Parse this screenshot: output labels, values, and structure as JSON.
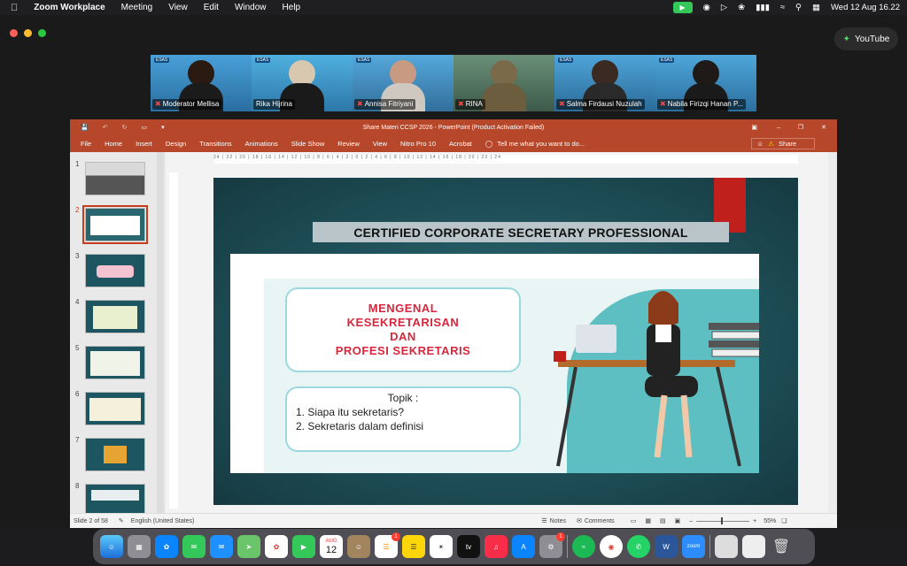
{
  "menubar": {
    "app": "Zoom Workplace",
    "items": [
      "Meeting",
      "View",
      "Edit",
      "Window",
      "Help"
    ],
    "datetime": "Wed 12 Aug  16.22"
  },
  "youtube": {
    "label": "YouTube"
  },
  "participants": [
    {
      "name": "Moderator Mellisa",
      "active": false
    },
    {
      "name": "Rika Hijrina",
      "active": true
    },
    {
      "name": "Annisa Fitriyani",
      "active": false
    },
    {
      "name": "RINA",
      "active": false
    },
    {
      "name": "Salma Firdausi Nuzulah",
      "active": false
    },
    {
      "name": "Nabila Firizqi Hanan P...",
      "active": false
    }
  ],
  "tile_logo": "ESAS",
  "ppt": {
    "window_title": "Share Materi CCSP 2026 - PowerPoint (Product Activation Failed)",
    "tabs": [
      "File",
      "Home",
      "Insert",
      "Design",
      "Transitions",
      "Animations",
      "Slide Show",
      "Review",
      "View",
      "Nitro Pro 10",
      "Acrobat"
    ],
    "tell_me": "Tell me what you want to do...",
    "share": "Share",
    "thumb_numbers": [
      "1",
      "2",
      "3",
      "4",
      "5",
      "6",
      "7",
      "8"
    ],
    "selected_slide": "2",
    "ruler_top": "24 | 22 | 20 | 18 | 16 | 14 | 12 | 10 | 8 | 6 | 4 | 2 | 0 | 2 | 4 | 6 | 8 | 10 | 12 | 14 | 16 | 18 | 20 | 22 | 24",
    "status": {
      "slide": "Slide 2 of 58",
      "language": "English (United States)",
      "notes": "Notes",
      "comments": "Comments",
      "zoom": "55%"
    }
  },
  "slide": {
    "title": "CERTIFIED CORPORATE SECRETARY PROFESSIONAL",
    "box_lines": [
      "MENGENAL",
      "KESEKRETARISAN",
      "DAN",
      "PROFESI SEKRETARIS"
    ],
    "topik": "Topik :",
    "items": [
      "1.   Siapa itu sekretaris?",
      "2.   Sekretaris dalam definisi"
    ]
  },
  "dock": {
    "calendar_month": "AUG",
    "calendar_day": "12",
    "reminders_badge": "1",
    "settings_badge": "1",
    "zoom_label": "zoom"
  }
}
